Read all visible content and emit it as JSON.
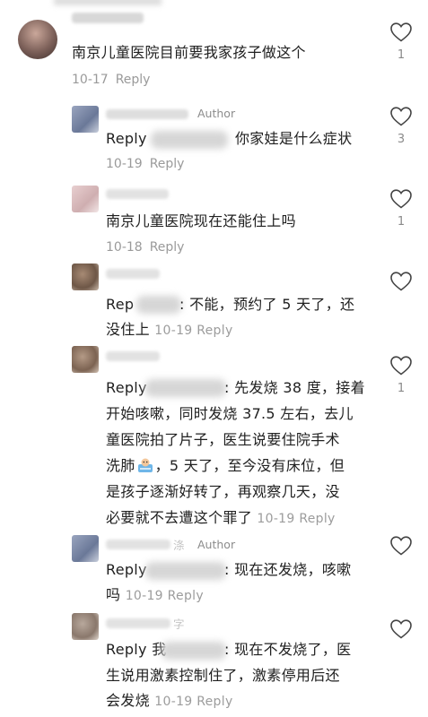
{
  "comments": [
    {
      "text": "南京儿童医院目前要我家孩子做这个",
      "date": "10-17",
      "reply": "Reply",
      "likes": "1"
    },
    {
      "author_tag": "Author",
      "prefix": "Reply",
      "text": "你家娃是什么症状",
      "date": "10-19",
      "reply": "Reply",
      "likes": "3"
    },
    {
      "text": "南京儿童医院现在还能住上吗",
      "date": "10-18",
      "reply": "Reply",
      "likes": "1"
    },
    {
      "prefix": "Rep",
      "text1": ": 不能，预约了 5 天了，还",
      "text2": "没住上",
      "date": "10-19",
      "reply": "Reply",
      "likes": ""
    },
    {
      "prefix": "Reply",
      "text1": ": 先发烧 38 度，接着",
      "text2": "开始咳嗽，同时发烧 37.5 左右，去儿",
      "text3": "童医院拍了片子，医生说要住院手术",
      "text4a": "洗肺",
      "text4b": "，5 天了，至今没有床位，但",
      "text5": "是孩子逐渐好转了，再观察几天，没",
      "text6": "必要就不去遭这个罪了",
      "date": "10-19",
      "reply": "Reply",
      "likes": "1"
    },
    {
      "author_tag": "Author",
      "name_frag": "涤",
      "prefix": "Reply",
      "text1": ": 现在还发烧，咳嗽",
      "text2": "吗",
      "date": "10-19",
      "reply": "Reply",
      "likes": ""
    },
    {
      "name_frag": "字",
      "prefix": "Reply 我",
      "text1": ": 现在不发烧了，医",
      "text2": "生说用激素控制住了，激素停用后还",
      "text3": "会发烧",
      "date": "10-19",
      "reply": "Reply",
      "likes": ""
    }
  ]
}
